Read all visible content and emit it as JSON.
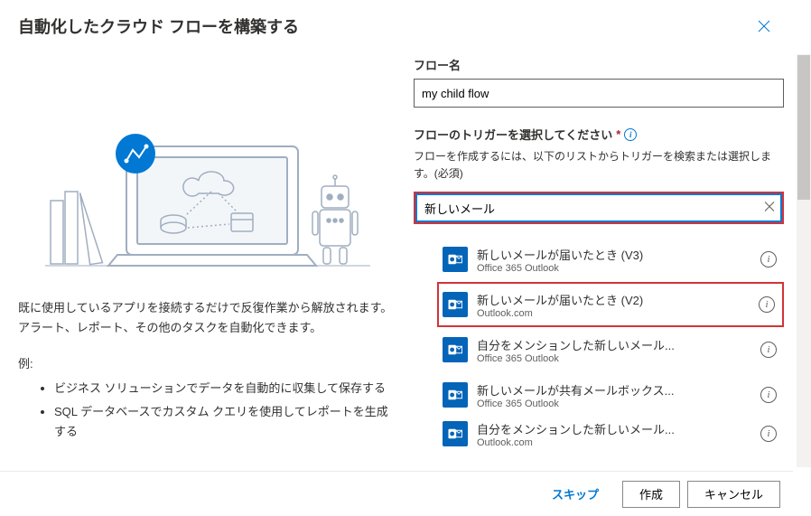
{
  "dialog": {
    "title": "自動化したクラウド フローを構築する"
  },
  "left": {
    "description": "既に使用しているアプリを接続するだけで反復作業から解放されます。アラート、レポート、その他のタスクを自動化できます。",
    "examples_label": "例:",
    "examples": [
      "ビジネス ソリューションでデータを自動的に収集して保存する",
      "SQL データベースでカスタム クエリを使用してレポートを生成する"
    ]
  },
  "right": {
    "flow_name_label": "フロー名",
    "flow_name_value": "my child flow",
    "trigger_label": "フローのトリガーを選択してください",
    "trigger_required": "*",
    "trigger_help": "フローを作成するには、以下のリストからトリガーを検索または選択します。(必須)",
    "search_value": "新しいメール",
    "triggers": [
      {
        "title": "新しいメールが届いたとき (V3)",
        "sub": "Office 365 Outlook",
        "selected": false
      },
      {
        "title": "新しいメールが届いたとき (V2)",
        "sub": "Outlook.com",
        "selected": true
      },
      {
        "title": "自分をメンションした新しいメール...",
        "sub": "Office 365 Outlook",
        "selected": false
      },
      {
        "title": "新しいメールが共有メールボックス...",
        "sub": "Office 365 Outlook",
        "selected": false
      },
      {
        "title": "自分をメンションした新しいメール...",
        "sub": "Outlook.com",
        "selected": false
      }
    ]
  },
  "footer": {
    "skip": "スキップ",
    "create": "作成",
    "cancel": "キャンセル"
  }
}
